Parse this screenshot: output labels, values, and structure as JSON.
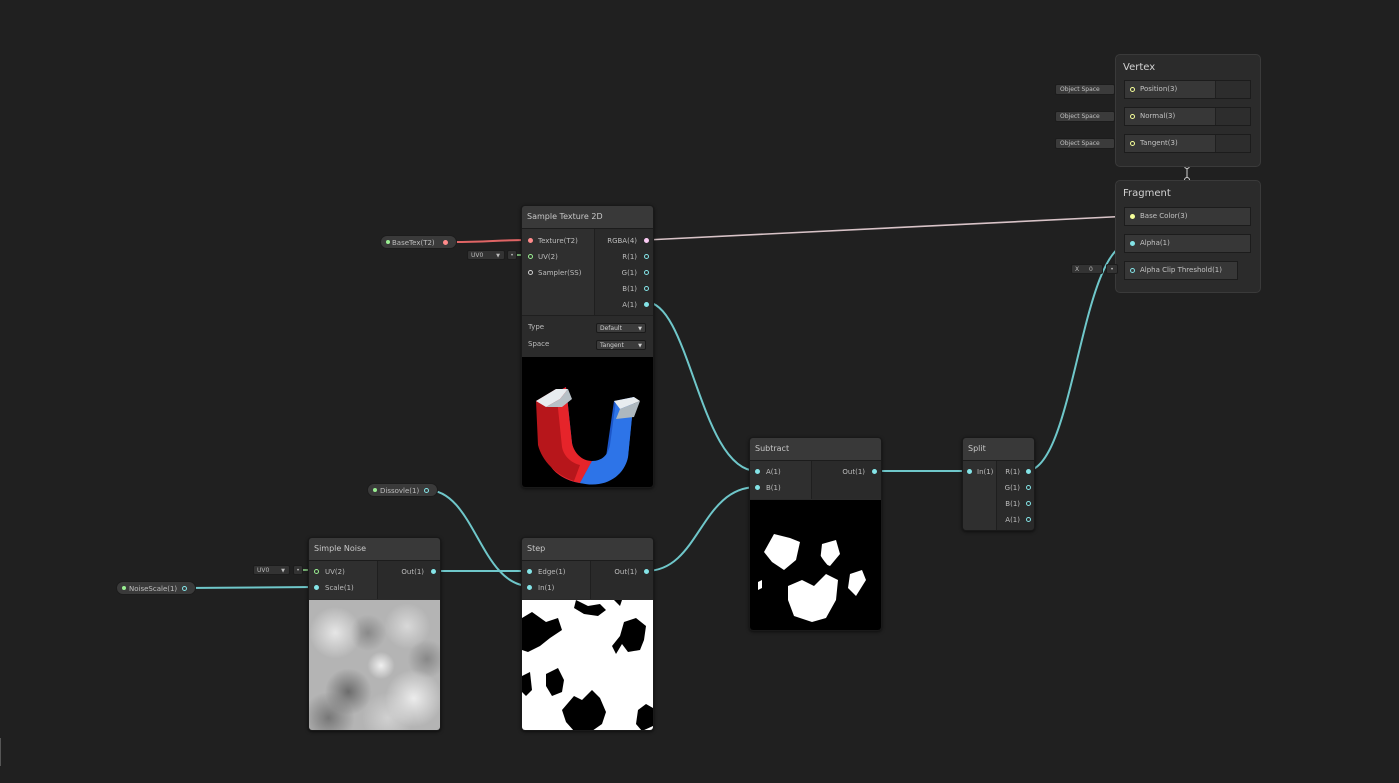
{
  "colors": {
    "background": "#202020",
    "float_port": "#84e4e7",
    "vector2_port": "#9aef92",
    "vector3_port": "#f6ff9a",
    "vector4_port": "#fbcbf4",
    "texture_port": "#ff8b8b"
  },
  "context_vertex": {
    "title": "Vertex",
    "slots": [
      {
        "label": "Position(3)",
        "space": "Object Space"
      },
      {
        "label": "Normal(3)",
        "space": "Object Space"
      },
      {
        "label": "Tangent(3)",
        "space": "Object Space"
      }
    ]
  },
  "context_fragment": {
    "title": "Fragment",
    "slots": [
      {
        "label": "Base Color(3)"
      },
      {
        "label": "Alpha(1)"
      },
      {
        "label": "Alpha Clip Threshold(1)"
      }
    ],
    "threshold_axis": "X",
    "threshold_value": "0"
  },
  "properties": {
    "base_tex": "BaseTex(T2)",
    "dissolve": "Dissovle(1)",
    "noise_scale": "NoiseScale(1)"
  },
  "sample_texture": {
    "title": "Sample Texture 2D",
    "inputs": [
      "Texture(T2)",
      "UV(2)",
      "Sampler(SS)"
    ],
    "outputs": [
      "RGBA(4)",
      "R(1)",
      "G(1)",
      "B(1)",
      "A(1)"
    ],
    "uv_channel": "UV0",
    "type_label": "Type",
    "type_value": "Default",
    "space_label": "Space",
    "space_value": "Tangent",
    "preview_icon": "magnet-icon"
  },
  "subtract": {
    "title": "Subtract",
    "inputs": [
      "A(1)",
      "B(1)"
    ],
    "outputs": [
      "Out(1)"
    ]
  },
  "split": {
    "title": "Split",
    "inputs": [
      "In(1)"
    ],
    "outputs": [
      "R(1)",
      "G(1)",
      "B(1)",
      "A(1)"
    ]
  },
  "simple_noise": {
    "title": "Simple Noise",
    "inputs": [
      "UV(2)",
      "Scale(1)"
    ],
    "outputs": [
      "Out(1)"
    ],
    "uv_channel": "UV0"
  },
  "step": {
    "title": "Step",
    "inputs": [
      "Edge(1)",
      "In(1)"
    ],
    "outputs": [
      "Out(1)"
    ]
  }
}
